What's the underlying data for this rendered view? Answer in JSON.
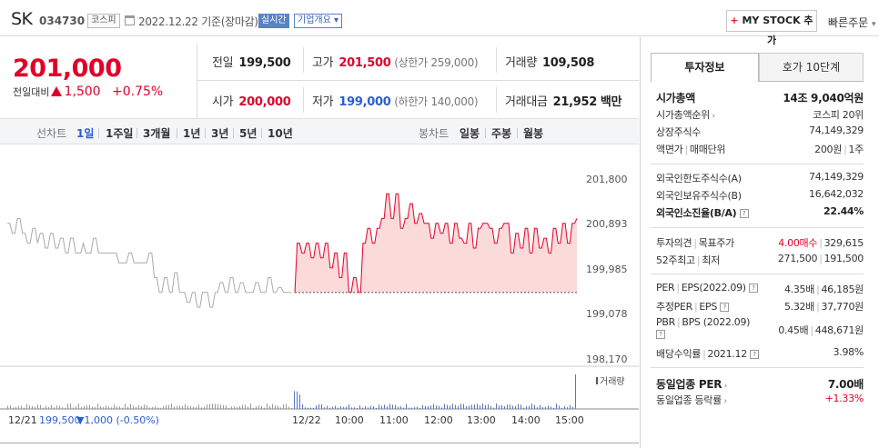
{
  "header": {
    "name": "SK",
    "code": "034730",
    "market_tag": "코스피",
    "date": "2022.12.22 기준(장마감)",
    "realtime_label": "실시간",
    "company_info_label": "기업개요",
    "mystock_plus": "+",
    "mystock_label": "MY STOCK 추가",
    "quick_order_label": "빠른주문"
  },
  "price": {
    "current": "201,000",
    "change_label": "전일대비",
    "change_amount": "1,500",
    "change_rate": "+0.75%"
  },
  "summary": {
    "prev_close_label": "전일",
    "prev_close": "199,500",
    "high_label": "고가",
    "high": "201,500",
    "upper_limit": "(상한가 259,000)",
    "volume_label": "거래량",
    "volume": "109,508",
    "open_label": "시가",
    "open": "200,000",
    "low_label": "저가",
    "low": "199,000",
    "lower_limit": "(하한가 140,000)",
    "value_label": "거래대금",
    "value": "21,952",
    "value_unit": "백만"
  },
  "period_tabs": {
    "line_label": "선차트",
    "items": [
      "1일",
      "1주일",
      "3개월",
      "1년",
      "3년",
      "5년",
      "10년"
    ],
    "selected": "1일",
    "candle_label": "봉차트",
    "candle_items": [
      "일봉",
      "주봉",
      "월봉"
    ]
  },
  "chart_data": {
    "type": "line",
    "title": "",
    "y_ticks": [
      "201,800",
      "200,893",
      "199,985",
      "199,078",
      "198,170"
    ],
    "ylim": [
      198170,
      201800
    ],
    "x_ticks": [
      "12/22",
      "10:00",
      "11:00",
      "12:00",
      "13:00",
      "14:00",
      "15:00"
    ],
    "prev_day_label": "12/21",
    "prev_day_close": "199,500",
    "prev_day_change": "▼1,000 (-0.50%)",
    "volume_label": "거래량",
    "series": [
      {
        "period": "previous-day",
        "color": "#aaaaaa",
        "values": [
          200900,
          200900,
          200700,
          200700,
          201000,
          201000,
          200700,
          200700,
          200500,
          200500,
          200800,
          200800,
          200500,
          200700,
          200700,
          200400,
          200400,
          200700,
          200700,
          200400,
          200400,
          200600,
          200600,
          200300,
          200300,
          200600,
          200600,
          200300,
          200300,
          200300,
          200500,
          200300,
          200300,
          200300,
          200600,
          200600,
          200300,
          200300,
          200300,
          200300,
          200300,
          200300,
          200300,
          200300,
          200100,
          200100,
          200100,
          200100,
          200300,
          200300,
          200100,
          200100,
          200100,
          200100,
          200100,
          200100,
          200300,
          200300,
          199800,
          199800,
          199500,
          199500,
          199800,
          199800,
          199500,
          199500,
          199900,
          199900,
          199500,
          199500,
          199500,
          199300,
          199300,
          199500,
          199500,
          199200,
          199200,
          199500,
          199500,
          199500,
          199200,
          199200,
          199500,
          199500,
          199700,
          199700,
          199500,
          199500,
          199800,
          199800,
          199500,
          199500,
          199700,
          199700,
          199500,
          199500,
          199500,
          199500,
          199700,
          199700,
          199500,
          199500,
          199500,
          199800,
          199800,
          199500,
          199500,
          199600,
          199600,
          199500,
          199500,
          199500,
          199500
        ]
      },
      {
        "period": "today",
        "color": "#e0002a",
        "baseline": 199500,
        "values": [
          199500,
          200500,
          200500,
          200300,
          200300,
          200500,
          200500,
          200200,
          200200,
          200500,
          200500,
          200200,
          200200,
          200500,
          200500,
          200000,
          200000,
          200300,
          200300,
          199800,
          199800,
          200300,
          200300,
          199500,
          199500,
          199800,
          199800,
          199500,
          199500,
          200500,
          200500,
          200800,
          200800,
          200500,
          200500,
          200800,
          200800,
          201000,
          201000,
          201500,
          201500,
          201000,
          201000,
          201500,
          201500,
          200800,
          200800,
          201000,
          201000,
          201300,
          201300,
          200900,
          200900,
          201100,
          201100,
          200900,
          200900,
          200900,
          200600,
          200600,
          200900,
          200900,
          200700,
          200700,
          200900,
          200900,
          200500,
          200500,
          200900,
          200900,
          200600,
          200600,
          200500,
          200500,
          200900,
          200900,
          200400,
          200400,
          200800,
          200800,
          200900,
          200900,
          200900,
          200800,
          200800,
          200500,
          200500,
          200800,
          200800,
          200900,
          200900,
          200900,
          200300,
          200300,
          200700,
          200700,
          200400,
          200400,
          200800,
          200800,
          200300,
          200300,
          200800,
          200800,
          200400,
          200400,
          200600,
          200600,
          200300,
          200300,
          200800,
          200800,
          200500,
          200500,
          200900,
          200900,
          200500,
          200500,
          200900,
          200900,
          201000
        ]
      }
    ]
  },
  "right_panel": {
    "tab_invest": "투자정보",
    "tab_orderbook": "호가 10단계",
    "market_cap_label": "시가총액",
    "market_cap": "14조 9,040억원",
    "market_cap_rank_label": "시가총액순위",
    "market_cap_rank": "코스피 20위",
    "shares_label": "상장주식수",
    "shares": "74,149,329",
    "face_value_label": "액면가",
    "trade_unit_label": "매매단위",
    "face_value": "200원",
    "trade_unit": "1주",
    "foreign_limit_label": "외국인한도주식수(A)",
    "foreign_limit": "74,149,329",
    "foreign_hold_label": "외국인보유주식수(B)",
    "foreign_hold": "16,642,032",
    "foreign_ratio_label": "외국인소진율(B/A)",
    "foreign_ratio": "22.44%",
    "opinion_label": "투자의견",
    "target_label": "목표주가",
    "opinion": "4.00매수",
    "target": "329,615",
    "high52_label": "52주최고",
    "low52_label": "최저",
    "high52": "271,500",
    "low52": "191,500",
    "per_label": "PER",
    "eps_label": "EPS(2022.09)",
    "per": "4.35배",
    "eps": "46,185원",
    "est_per_label": "추정PER",
    "est_eps_label": "EPS",
    "est_per": "5.32배",
    "est_eps": "37,770원",
    "pbr_label": "PBR",
    "bps_label": "BPS (2022.09)",
    "pbr": "0.45배",
    "bps": "448,671원",
    "dividend_label": "배당수익률",
    "dividend_date": "2021.12",
    "dividend": "3.98%",
    "industry_per_label": "동일업종 PER",
    "industry_per": "7.00배",
    "industry_rate_label": "동일업종 등락률",
    "industry_rate": "+1.33%",
    "note_mark": "?"
  }
}
